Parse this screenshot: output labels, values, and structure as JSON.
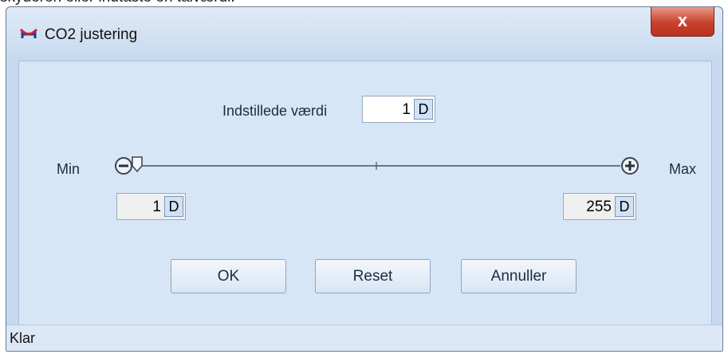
{
  "background_text": "skyderen eller indtaste en talværdi.",
  "window": {
    "title": "CO2 justering",
    "close_label": "x"
  },
  "setpoint": {
    "label": "Indstillede værdi",
    "value": "1",
    "unit_button": "D"
  },
  "range": {
    "min_label": "Min",
    "max_label": "Max",
    "min_value": "1",
    "min_unit": "D",
    "max_value": "255",
    "max_unit": "D"
  },
  "slider": {
    "min": 1,
    "max": 255,
    "value": 1,
    "decrease_icon": "minus-circle-icon",
    "increase_icon": "plus-circle-icon"
  },
  "buttons": {
    "ok": "OK",
    "reset": "Reset",
    "cancel": "Annuller"
  },
  "status": {
    "text": "Klar"
  },
  "colors": {
    "close_button": "#c7412b",
    "window_bg": "#c7d9ee",
    "client_bg": "#d7e6f7"
  }
}
